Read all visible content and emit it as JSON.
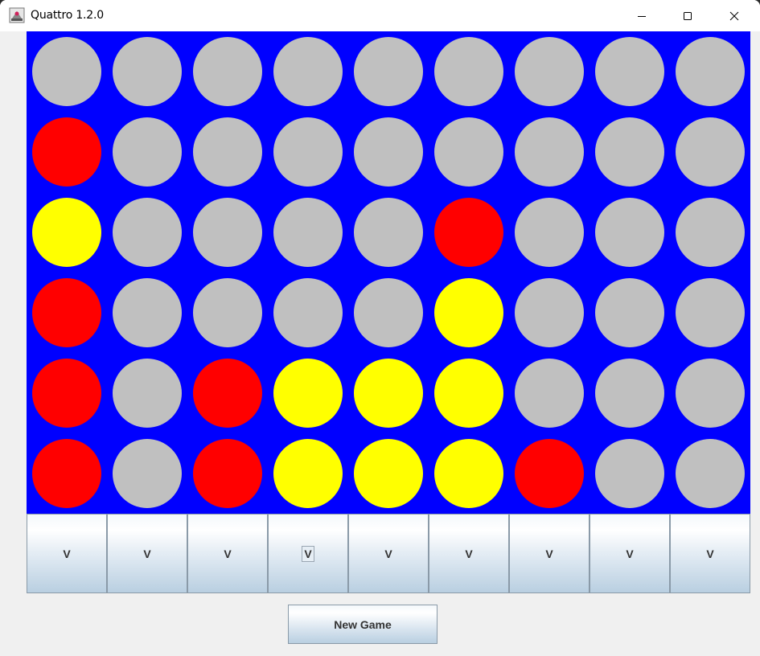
{
  "window": {
    "title": "Quattro 1.2.0",
    "controls": [
      "minimize",
      "maximize",
      "close"
    ]
  },
  "board": {
    "columns": 9,
    "rows": 6,
    "colors": {
      "board": "#0000ff",
      "empty": "#c0c0c0",
      "red": "#ff0000",
      "yellow": "#ffff00"
    },
    "cells": [
      [
        "empty",
        "empty",
        "empty",
        "empty",
        "empty",
        "empty",
        "empty",
        "empty",
        "empty"
      ],
      [
        "red",
        "empty",
        "empty",
        "empty",
        "empty",
        "empty",
        "empty",
        "empty",
        "empty"
      ],
      [
        "yellow",
        "empty",
        "empty",
        "empty",
        "empty",
        "red",
        "empty",
        "empty",
        "empty"
      ],
      [
        "red",
        "empty",
        "empty",
        "empty",
        "empty",
        "yellow",
        "empty",
        "empty",
        "empty"
      ],
      [
        "red",
        "empty",
        "red",
        "yellow",
        "yellow",
        "yellow",
        "empty",
        "empty",
        "empty"
      ],
      [
        "red",
        "empty",
        "red",
        "yellow",
        "yellow",
        "yellow",
        "red",
        "empty",
        "empty"
      ]
    ]
  },
  "drop_buttons": [
    {
      "label": "V",
      "focused": false
    },
    {
      "label": "V",
      "focused": false
    },
    {
      "label": "V",
      "focused": false
    },
    {
      "label": "V",
      "focused": true
    },
    {
      "label": "V",
      "focused": false
    },
    {
      "label": "V",
      "focused": false
    },
    {
      "label": "V",
      "focused": false
    },
    {
      "label": "V",
      "focused": false
    },
    {
      "label": "V",
      "focused": false
    }
  ],
  "new_game_label": "New Game"
}
